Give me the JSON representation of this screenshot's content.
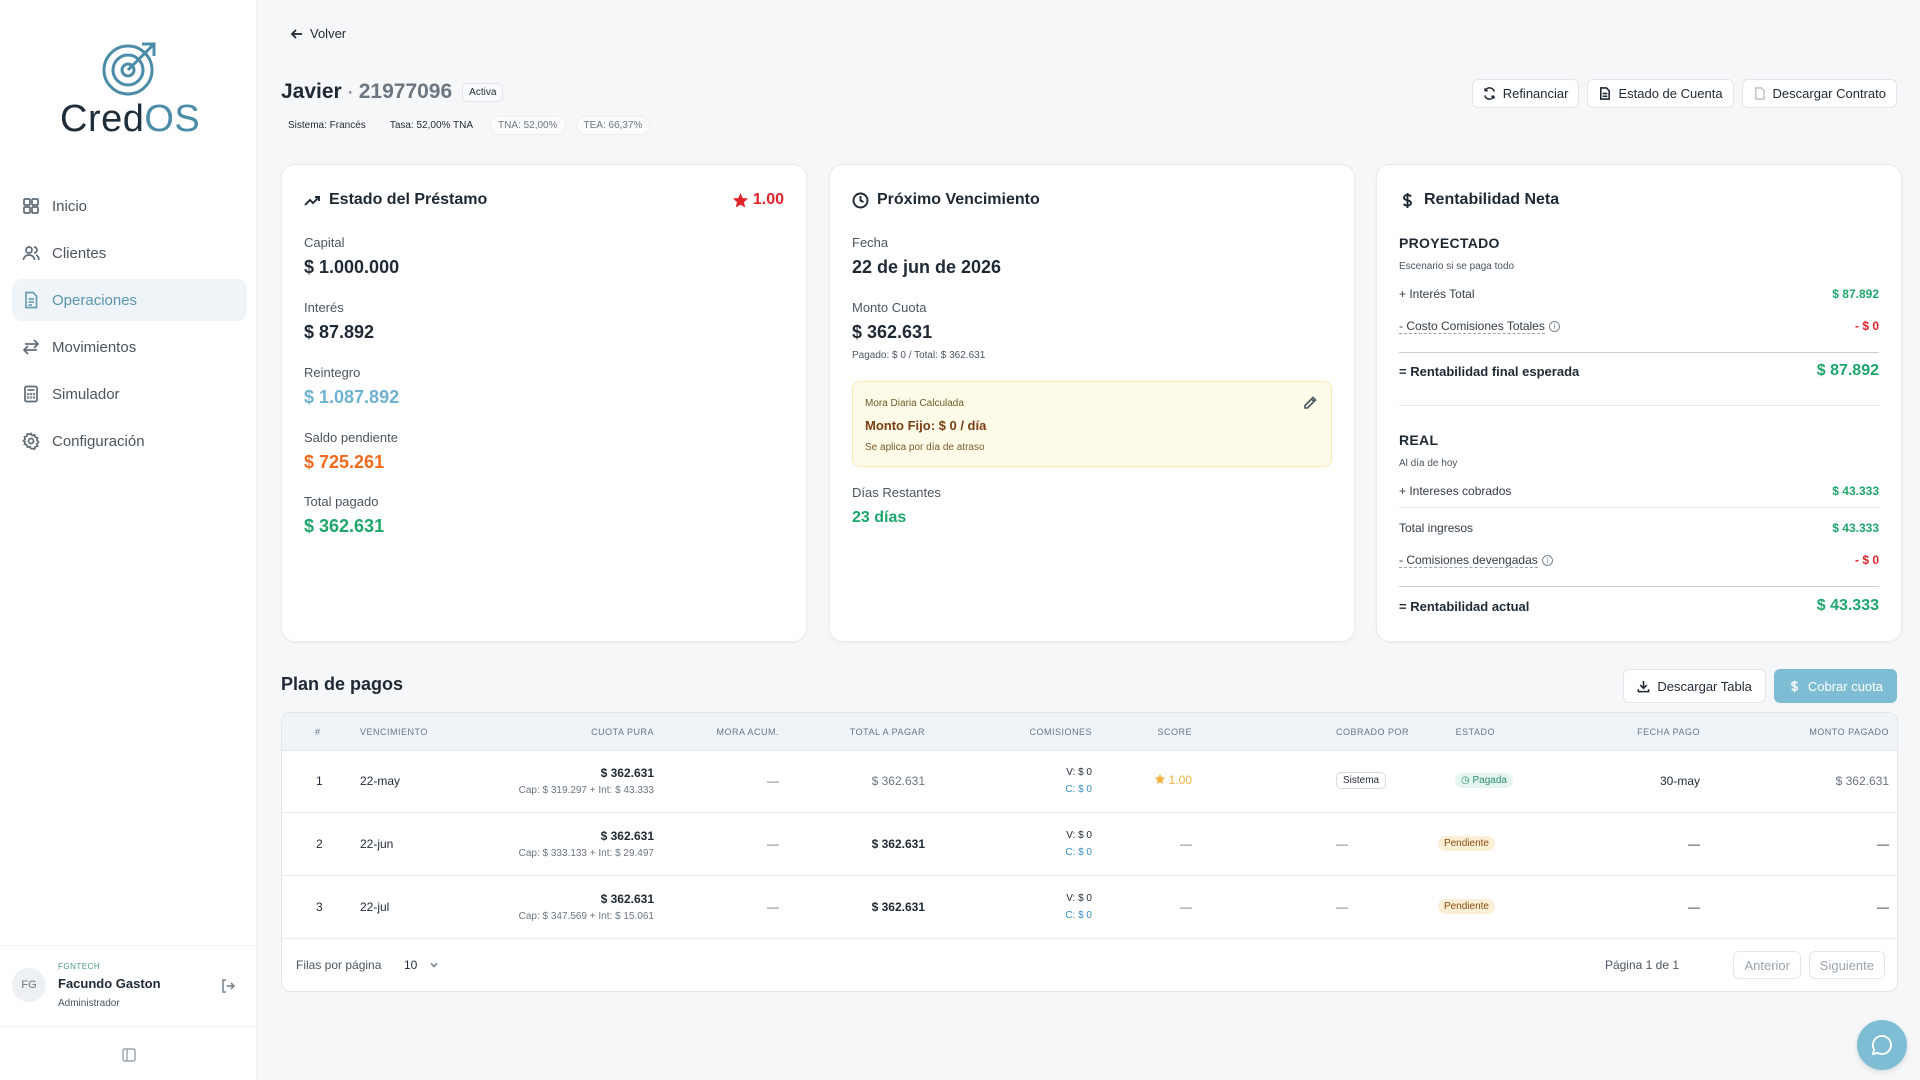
{
  "brand": {
    "part1": "Cred",
    "part2": "OS"
  },
  "sidebar": {
    "items": [
      {
        "label": "Inicio",
        "icon": "grid-icon"
      },
      {
        "label": "Clientes",
        "icon": "users-icon"
      },
      {
        "label": "Operaciones",
        "icon": "document-icon",
        "active": true
      },
      {
        "label": "Movimientos",
        "icon": "arrows-icon"
      },
      {
        "label": "Simulador",
        "icon": "calculator-icon"
      },
      {
        "label": "Configuración",
        "icon": "gear-icon"
      }
    ],
    "user": {
      "initials": "FG",
      "company": "FGNTECH",
      "name": "Facundo Gaston",
      "role": "Administrador"
    }
  },
  "header": {
    "back_label": "Volver",
    "name": "Javier",
    "separator": "·",
    "id": "21977096",
    "status": "Activa",
    "sistema": "Sistema: Francés",
    "tasa": "Tasa: 52,00% TNA",
    "tna": "TNA: 52,00%",
    "tea": "TEA: 66,37%",
    "actions": {
      "refinanciar": "Refinanciar",
      "estado": "Estado de Cuenta",
      "contrato": "Descargar Contrato"
    }
  },
  "estado": {
    "title": "Estado del Préstamo",
    "score": "1.00",
    "capital_label": "Capital",
    "capital": "$ 1.000.000",
    "interes_label": "Interés",
    "interes": "$ 87.892",
    "reintegro_label": "Reintegro",
    "reintegro": "$ 1.087.892",
    "saldo_label": "Saldo pendiente",
    "saldo": "$ 725.261",
    "pagado_label": "Total pagado",
    "pagado": "$ 362.631"
  },
  "vencimiento": {
    "title": "Próximo Vencimiento",
    "fecha_label": "Fecha",
    "fecha": "22 de jun de 2026",
    "monto_label": "Monto Cuota",
    "monto": "$ 362.631",
    "monto_detail": "Pagado: $ 0 / Total: $ 362.631",
    "mora_label": "Mora Diaria Calculada",
    "mora_value": "Monto Fijo: $ 0 / día",
    "mora_note": "Se aplica por día de atraso",
    "dias_label": "Días Restantes",
    "dias": "23 días"
  },
  "rentabilidad": {
    "title": "Rentabilidad Neta",
    "proy_title": "PROYECTADO",
    "proy_sub": "Escenario si se paga todo",
    "interes_total_label": "+ Interés Total",
    "interes_total": "$ 87.892",
    "costo_label": "- Costo Comisiones Totales",
    "costo": "- $ 0",
    "final_label": "= Rentabilidad final esperada",
    "final": "$ 87.892",
    "real_title": "REAL",
    "real_sub": "Al día de hoy",
    "cobrados_label": "+ Intereses cobrados",
    "cobrados": "$ 43.333",
    "ingresos_label": "Total ingresos",
    "ingresos": "$ 43.333",
    "devengadas_label": "- Comisiones devengadas",
    "devengadas": "- $ 0",
    "actual_label": "= Rentabilidad actual",
    "actual": "$ 43.333"
  },
  "plan": {
    "title": "Plan de pagos",
    "download_label": "Descargar Tabla",
    "cobrar_label": "Cobrar cuota",
    "columns": [
      "#",
      "VENCIMIENTO",
      "CUOTA PURA",
      "MORA ACUM.",
      "TOTAL A PAGAR",
      "COMISIONES",
      "SCORE",
      "COBRADO POR",
      "ESTADO",
      "FECHA PAGO",
      "MONTO PAGADO"
    ],
    "rows": [
      {
        "n": "1",
        "venc": "22-may",
        "cuota": "$ 362.631",
        "detalle": "Cap: $ 319.297 + Int: $ 43.333",
        "mora": "—",
        "total": "$ 362.631",
        "com_v": "V: $ 0",
        "com_c": "C: $ 0",
        "score": "1.00",
        "cobrado": "Sistema",
        "estado": "Pagada",
        "fecha": "30-may",
        "monto": "$ 362.631"
      },
      {
        "n": "2",
        "venc": "22-jun",
        "cuota": "$ 362.631",
        "detalle": "Cap: $ 333.133 + Int: $ 29.497",
        "mora": "—",
        "total": "$ 362.631",
        "com_v": "V: $ 0",
        "com_c": "C: $ 0",
        "score": "—",
        "cobrado": "—",
        "estado": "Pendiente",
        "fecha": "—",
        "monto": "—"
      },
      {
        "n": "3",
        "venc": "22-jul",
        "cuota": "$ 362.631",
        "detalle": "Cap: $ 347.569 + Int: $ 15.061",
        "mora": "—",
        "total": "$ 362.631",
        "com_v": "V: $ 0",
        "com_c": "C: $ 0",
        "score": "—",
        "cobrado": "—",
        "estado": "Pendiente",
        "fecha": "—",
        "monto": "—"
      }
    ],
    "rows_label": "Filas por página",
    "rows_value": "10",
    "page_label": "Página 1 de 1",
    "prev": "Anterior",
    "next": "Siguiente"
  },
  "colors": {
    "accent": "#7fbdd5",
    "green": "#1fa66b",
    "red": "#e0242b",
    "orange": "#f06a1d",
    "blue_light": "#6fb2cf"
  }
}
